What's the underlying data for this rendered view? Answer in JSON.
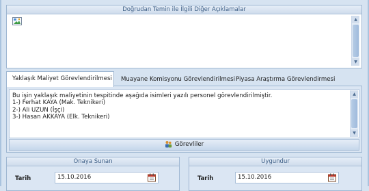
{
  "group_top": {
    "title": "Doğrudan Temin ile İlgili Diğer Açıklamalar",
    "memo_value": ""
  },
  "tabs": [
    {
      "label": "Yaklaşık Maliyet Görevlendirilmesi",
      "active": true
    },
    {
      "label": "Muayane Komisyonu Görevlendirilmesi",
      "active": false
    },
    {
      "label": "Piyasa Araştırma Görevlendirmesi",
      "active": false
    }
  ],
  "memo": {
    "lines": [
      "Bu işin yaklaşık maliyetinin tespitinde aşağıda isimleri yazılı personel görevlendirilmiştir.",
      "1-) Ferhat KAYA (Mak. Teknikeri)",
      "2-) Ali UZUN (İşçi)",
      "3-) Hasan AKKAYA (Elk. Teknikeri)"
    ]
  },
  "gorevliler_button": {
    "label": "Görevliler",
    "icon": "people-icon"
  },
  "onaya_sunan": {
    "title": "Onaya Sunan",
    "date_label": "Tarih",
    "date_value": "15.10.2016",
    "icon": "calendar-icon"
  },
  "uygundur": {
    "title": "Uygundur",
    "date_label": "Tarih",
    "date_value": "15.10.2016",
    "icon": "calendar-icon"
  },
  "colors": {
    "accent": "#3e5f86",
    "panel": "#dbe6f3",
    "border": "#9fb7d2"
  }
}
